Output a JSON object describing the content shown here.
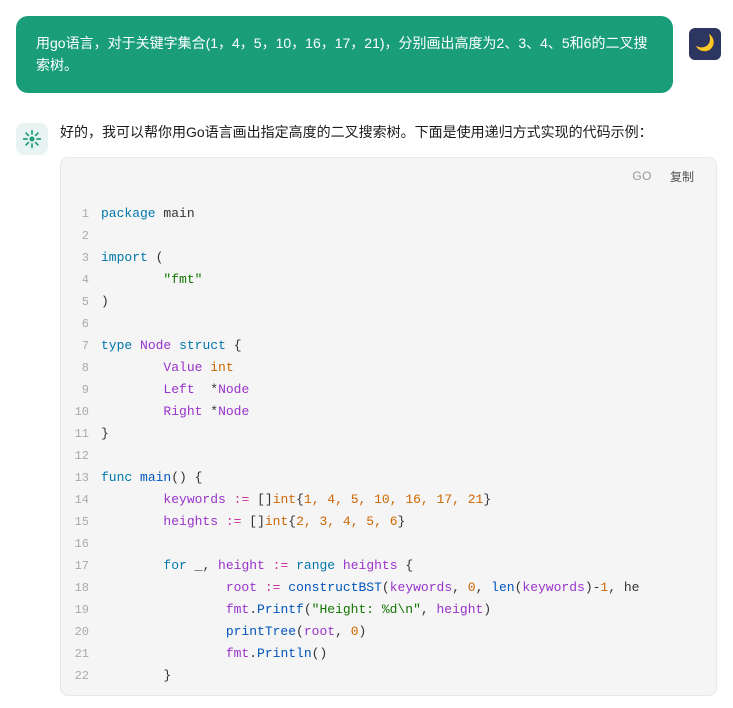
{
  "user_message": {
    "text": "用go语言，对于关键字集合(1，4，5，10，16，17，21)，分别画出高度为2、3、4、5和6的二叉搜索树。",
    "icon": "🌙"
  },
  "ai_message": {
    "intro_text": "好的，我可以帮你用Go语言画出指定高度的二叉搜索树。下面是使用递归方式实现的代码示例：",
    "code_lang": "GO",
    "copy_label": "复制"
  },
  "code_lines": [
    {
      "num": 1,
      "content": "package main"
    },
    {
      "num": 2,
      "content": ""
    },
    {
      "num": 3,
      "content": "import ("
    },
    {
      "num": 4,
      "content": "        \"fmt\""
    },
    {
      "num": 5,
      "content": ")"
    },
    {
      "num": 6,
      "content": ""
    },
    {
      "num": 7,
      "content": "type Node struct {"
    },
    {
      "num": 8,
      "content": "        Value int"
    },
    {
      "num": 9,
      "content": "        Left  *Node"
    },
    {
      "num": 10,
      "content": "        Right *Node"
    },
    {
      "num": 11,
      "content": "}"
    },
    {
      "num": 12,
      "content": ""
    },
    {
      "num": 13,
      "content": "func main() {"
    },
    {
      "num": 14,
      "content": "        keywords := []int{1, 4, 5, 10, 16, 17, 21}"
    },
    {
      "num": 15,
      "content": "        heights := []int{2, 3, 4, 5, 6}"
    },
    {
      "num": 16,
      "content": ""
    },
    {
      "num": 17,
      "content": "        for _, height := range heights {"
    },
    {
      "num": 18,
      "content": "                root := constructBST(keywords, 0, len(keywords)-1, he"
    },
    {
      "num": 19,
      "content": "                fmt.Printf(\"Height: %d\\n\", height)"
    },
    {
      "num": 20,
      "content": "                printTree(root, 0)"
    },
    {
      "num": 21,
      "content": "                fmt.Println()"
    },
    {
      "num": 22,
      "content": "        }"
    }
  ],
  "colors": {
    "user_bg": "#1a9e7a",
    "user_icon_bg": "#2d3561",
    "code_bg": "#f5f5f5",
    "ai_avatar_bg": "#e8f4f1"
  }
}
